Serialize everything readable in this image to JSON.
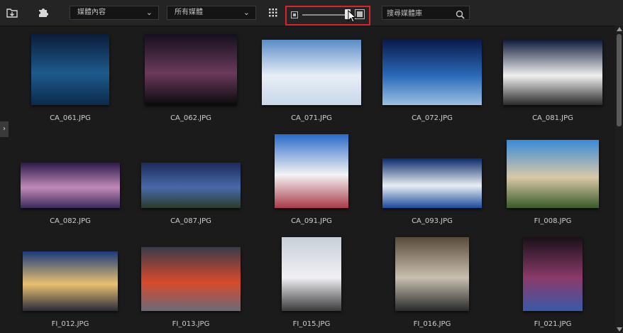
{
  "toolbar": {
    "import_icon": "import-folder-icon",
    "plugin_icon": "puzzle-plugin-icon",
    "category_dropdown": {
      "value": "媒體內容"
    },
    "filter_dropdown": {
      "value": "所有媒體"
    },
    "view_icon": "grid-view-icon",
    "thumbnail_size_slider": {
      "level": 0.85
    },
    "search": {
      "placeholder": "搜尋媒體庫"
    }
  },
  "media": [
    {
      "filename": "CA_061.JPG",
      "thumb_colors": [
        "#0a1c3a",
        "#1e5a8c",
        "#0b2a4a"
      ]
    },
    {
      "filename": "CA_062.JPG",
      "thumb_colors": [
        "#140f1e",
        "#6a3a5a",
        "#0a0a0c"
      ]
    },
    {
      "filename": "CA_071.JPG",
      "thumb_colors": [
        "#5a8cc8",
        "#e8eef6",
        "#c8d8ea"
      ]
    },
    {
      "filename": "CA_072.JPG",
      "thumb_colors": [
        "#0a1a4a",
        "#2a6ab8",
        "#9cc0e0"
      ]
    },
    {
      "filename": "CA_081.JPG",
      "thumb_colors": [
        "#0e1a3a",
        "#f0f0f0",
        "#2a2a2a"
      ]
    },
    {
      "filename": "CA_082.JPG",
      "thumb_colors": [
        "#2a1a4a",
        "#c08ab8",
        "#3a2a5a"
      ]
    },
    {
      "filename": "CA_087.JPG",
      "thumb_colors": [
        "#1a2a5a",
        "#4a6aa8",
        "#2a3a2a"
      ]
    },
    {
      "filename": "CA_091.JPG",
      "thumb_colors": [
        "#2a6ac8",
        "#f4f4f4",
        "#a83a4a"
      ]
    },
    {
      "filename": "CA_093.JPG",
      "thumb_colors": [
        "#0a2a6a",
        "#e8eef4",
        "#1a4a9a"
      ]
    },
    {
      "filename": "FI_008.JPG",
      "thumb_colors": [
        "#3a8ad8",
        "#d8c8a8",
        "#3a5a2a"
      ]
    },
    {
      "filename": "FI_012.JPG",
      "thumb_colors": [
        "#1a3a7a",
        "#e8c070",
        "#2a2a3a"
      ]
    },
    {
      "filename": "FI_013.JPG",
      "thumb_colors": [
        "#3a3a4a",
        "#d84a2a",
        "#6a6a7a"
      ]
    },
    {
      "filename": "FI_015.JPG",
      "thumb_colors": [
        "#c8d0d8",
        "#f0f0f4",
        "#3a3a3a"
      ]
    },
    {
      "filename": "FI_016.JPG",
      "thumb_colors": [
        "#5a4a3a",
        "#c8c0b0",
        "#2a2a2a"
      ]
    },
    {
      "filename": "FI_021.JPG",
      "thumb_colors": [
        "#1a1018",
        "#8a3a6a",
        "#3a5aa8"
      ]
    }
  ],
  "left_panel_toggle": {
    "glyph": "›"
  }
}
